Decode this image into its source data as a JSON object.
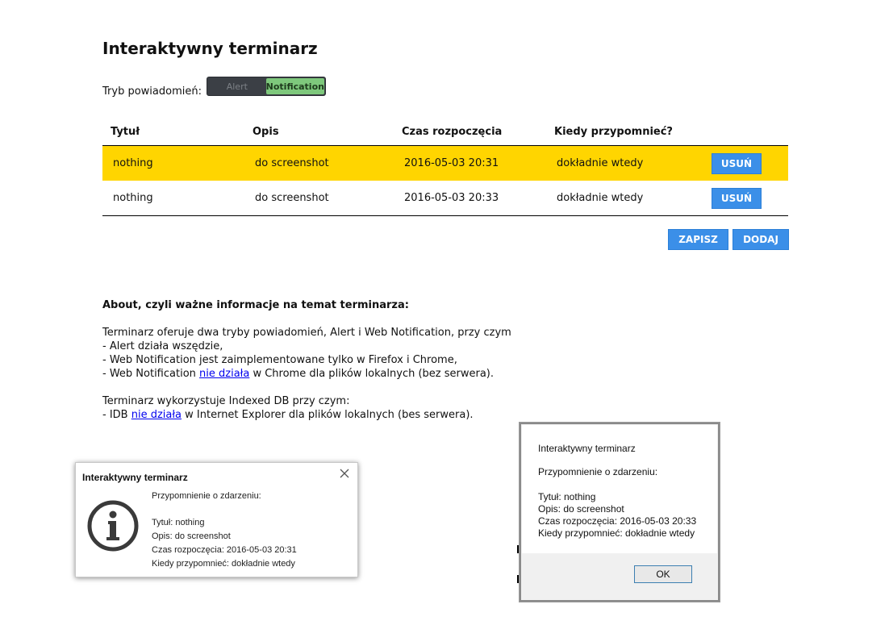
{
  "page": {
    "title": "Interaktywny terminarz",
    "mode_label": "Tryb powiadomień:",
    "mode_options": [
      "Alert",
      "Notification"
    ],
    "mode_selected": "Notification"
  },
  "table": {
    "headers": [
      "Tytuł",
      "Opis",
      "Czas rozpoczęcia",
      "Kiedy przypomnieć?"
    ],
    "rows": [
      {
        "title": "nothing",
        "desc": "do screenshot",
        "start": "2016-05-03 20:31",
        "remind": "dokładnie wtedy",
        "delete_label": "USUŃ",
        "highlighted": true
      },
      {
        "title": "nothing",
        "desc": "do screenshot",
        "start": "2016-05-03 20:33",
        "remind": "dokładnie wtedy",
        "delete_label": "USUŃ",
        "highlighted": false
      }
    ],
    "save_label": "ZAPISZ",
    "add_label": "DODAJ"
  },
  "about": {
    "heading": "About, czyli ważne informacje na temat terminarza:",
    "p1": "Terminarz oferuje dwa tryby powiadomień, Alert i Web Notification, przy czym",
    "b1": "- Alert działa wszędzie,",
    "b2": "- Web Notification jest zaimplementowane tylko w Firefox i Chrome,",
    "b3_pre": "- Web Notification ",
    "b3_link": "nie działa",
    "b3_post": " w Chrome dla plików lokalnych (bez serwera).",
    "p2": "Terminarz wykorzystuje Indexed DB przy czym:",
    "b4_pre": "- IDB ",
    "b4_link": "nie działa",
    "b4_post": " w Internet Explorer dla plików lokalnych (bes serwera)."
  },
  "alert_dialog": {
    "title": "Interaktywny terminarz",
    "line1": "Przypomnienie o zdarzeniu:",
    "line2": "Tytuł: nothing",
    "line3": "Opis: do screenshot",
    "line4": "Czas rozpoczęcia: 2016-05-03 20:33",
    "line5": "Kiedy przypomnieć: dokładnie wtedy",
    "ok_label": "OK"
  },
  "notification": {
    "title": "Interaktywny terminarz",
    "close_icon": "close-icon",
    "icon": "info-icon",
    "line1": "Przypomnienie o zdarzeniu:",
    "line2": "Tytuł: nothing",
    "line3": "Opis: do screenshot",
    "line4": "Czas rozpoczęcia: 2016-05-03 20:31",
    "line5": "Kiedy przypomnieć: dokładnie wtedy"
  },
  "colors": {
    "highlight_row": "#ffd500",
    "button_blue": "#3b8fe8",
    "toggle_on": "#7ec87c",
    "toggle_bg": "#3b3f45"
  }
}
